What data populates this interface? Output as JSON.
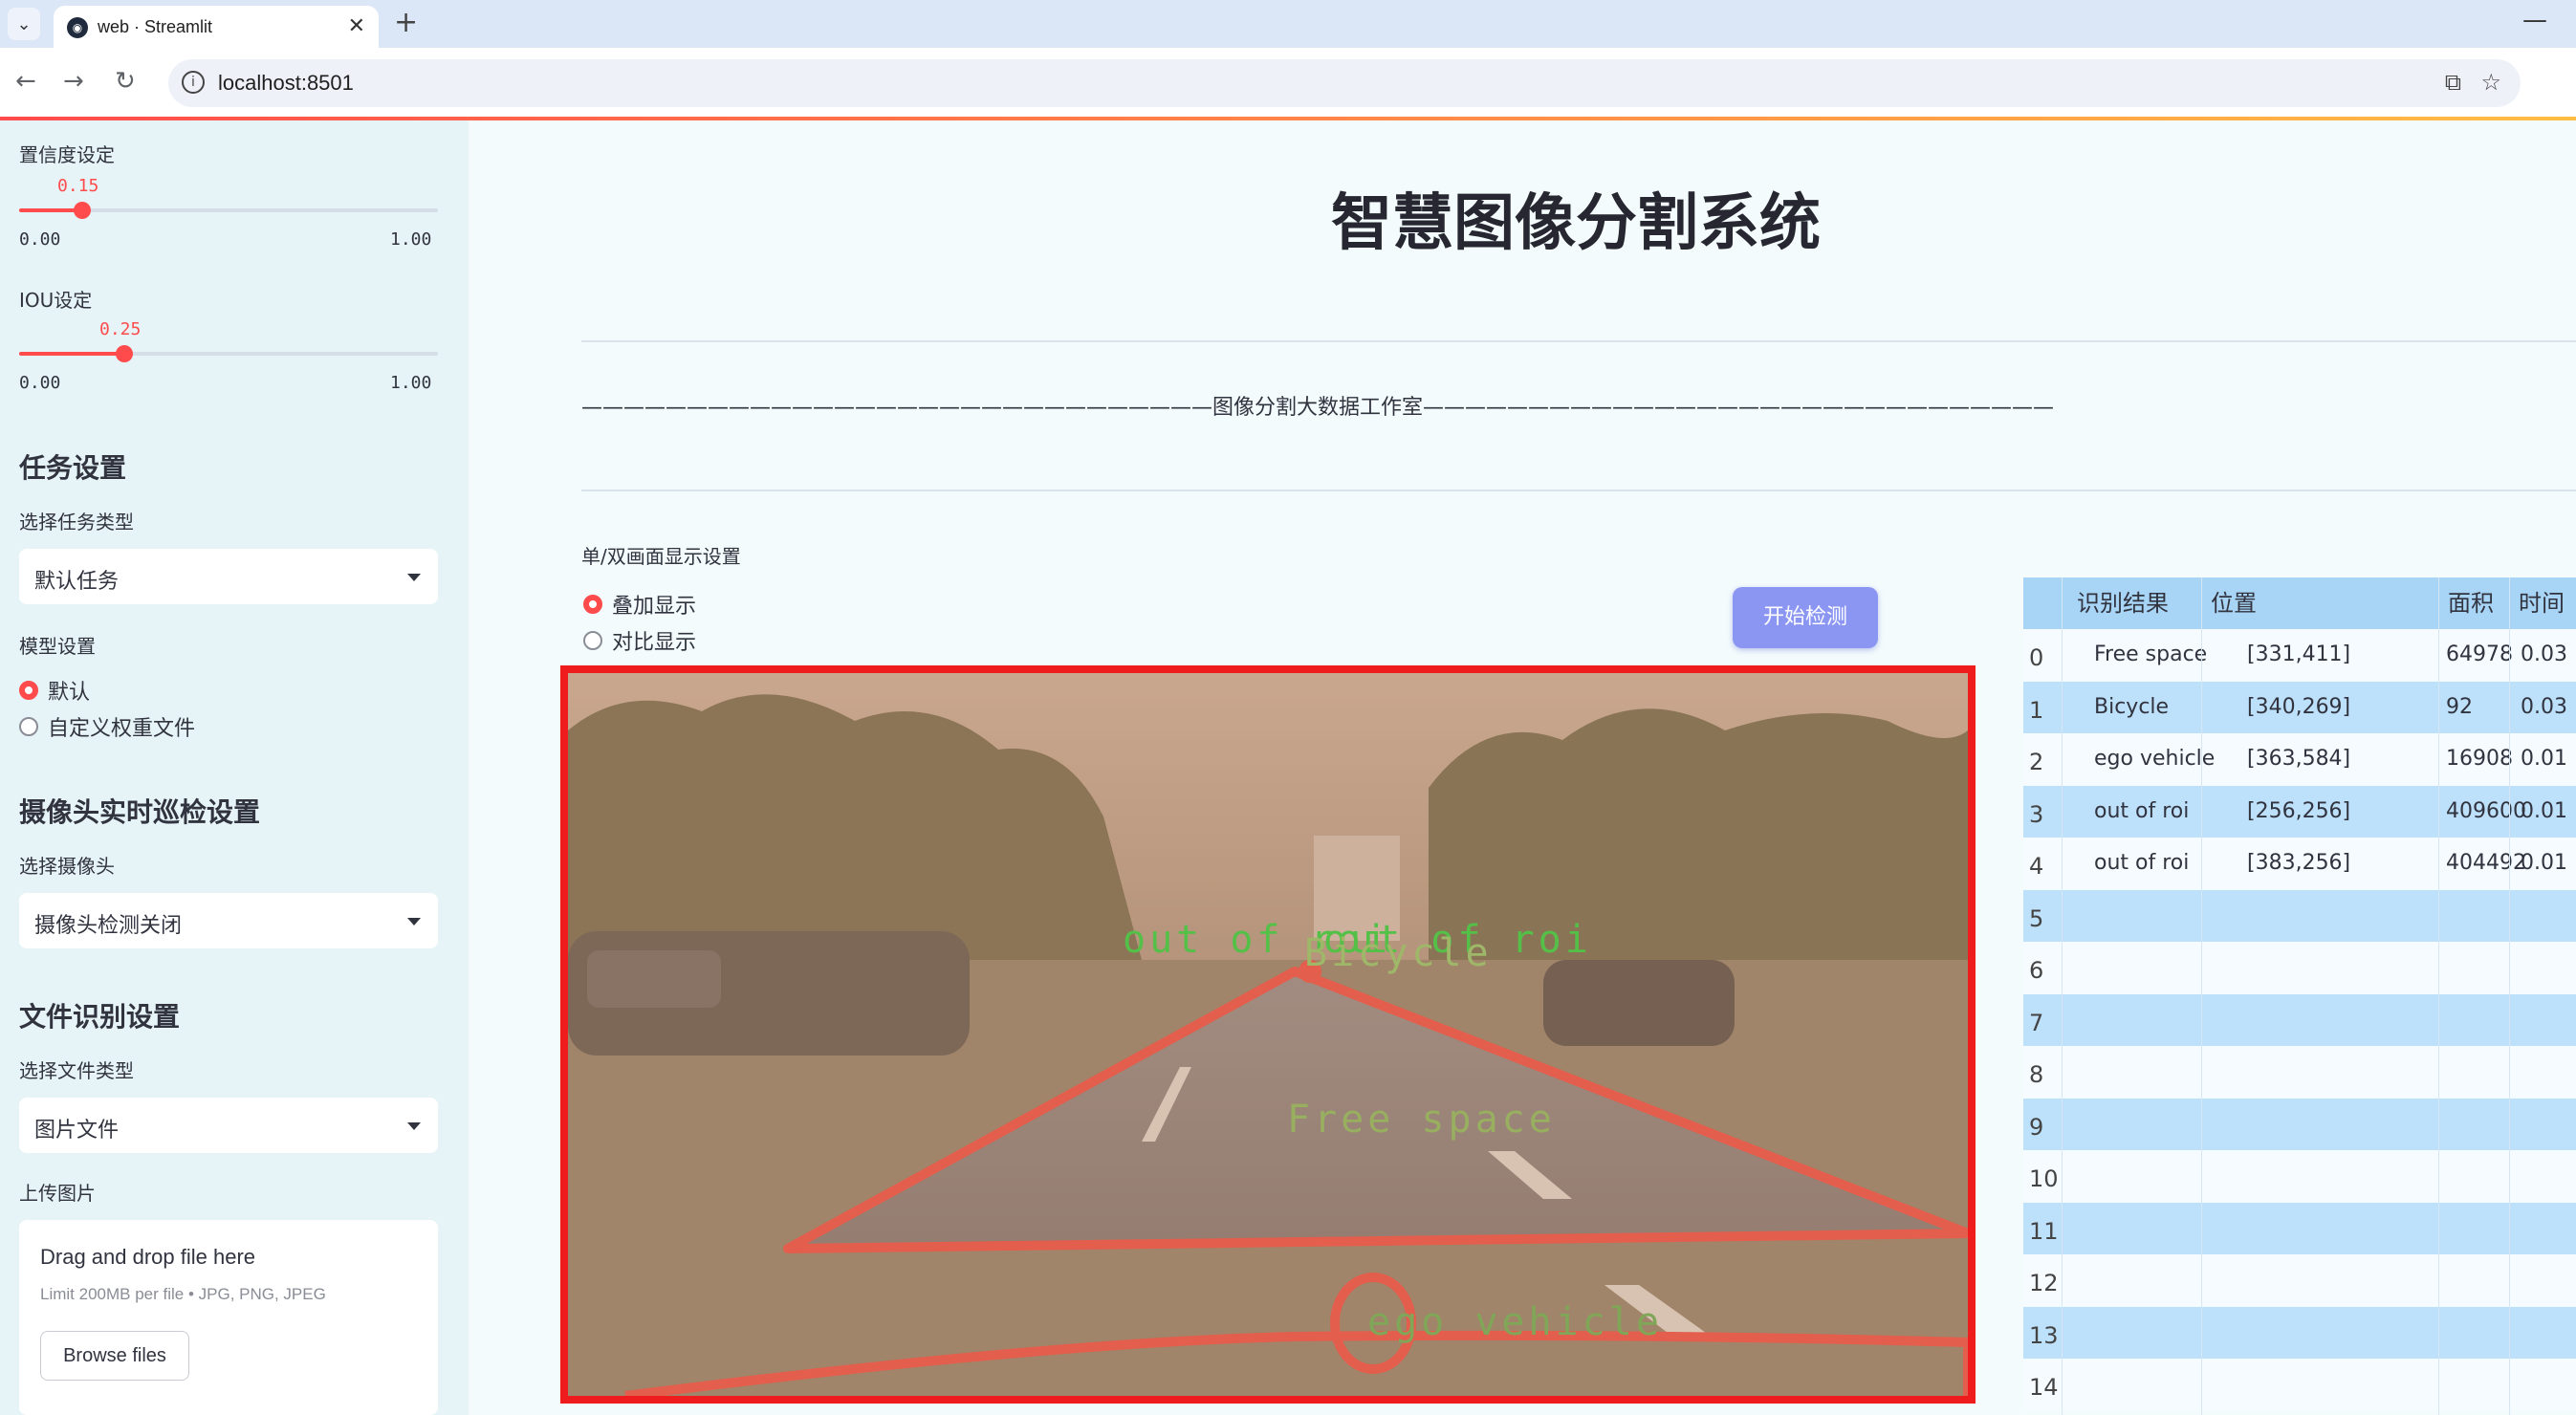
{
  "browser": {
    "tab_title": "web · Streamlit",
    "url": "localhost:8501"
  },
  "sidebar": {
    "confidence": {
      "label": "置信度设定",
      "value": "0.15",
      "min": "0.00",
      "max": "1.00",
      "fraction": 0.15
    },
    "iou": {
      "label": "IOU设定",
      "value": "0.25",
      "min": "0.00",
      "max": "1.00",
      "fraction": 0.25
    },
    "task_heading": "任务设置",
    "task_type_label": "选择任务类型",
    "task_type_value": "默认任务",
    "model_label": "模型设置",
    "model_options": [
      "默认",
      "自定义权重文件"
    ],
    "model_selected": 0,
    "camera_heading": "摄像头实时巡检设置",
    "camera_label": "选择摄像头",
    "camera_value": "摄像头检测关闭",
    "file_heading": "文件识别设置",
    "file_type_label": "选择文件类型",
    "file_type_value": "图片文件",
    "upload_label": "上传图片",
    "upload_drag": "Drag and drop file here",
    "upload_limit": "Limit 200MB per file • JPG, PNG, JPEG",
    "upload_button": "Browse files"
  },
  "main": {
    "title": "智慧图像分割系统",
    "banner": "——————————————————————————————图像分割大数据工作室——————————————————————————————",
    "display_label": "单/双画面显示设置",
    "display_options": [
      "叠加显示",
      "对比显示"
    ],
    "display_selected": 0,
    "start_button": "开始检测",
    "image_labels": [
      "out of roi",
      "out of roi",
      "Bicycle",
      "Free space",
      "ego vehicle"
    ]
  },
  "results_table": {
    "columns": [
      "识别结果",
      "位置",
      "面积",
      "时间"
    ],
    "rows": [
      {
        "idx": "0",
        "label": "Free space",
        "pos": "[331,411]",
        "area": "64978",
        "time": "0.03"
      },
      {
        "idx": "1",
        "label": "Bicycle",
        "pos": "[340,269]",
        "area": "92",
        "time": "0.03"
      },
      {
        "idx": "2",
        "label": "ego vehicle",
        "pos": "[363,584]",
        "area": "16908",
        "time": "0.01"
      },
      {
        "idx": "3",
        "label": "out of roi",
        "pos": "[256,256]",
        "area": "409600",
        "time": "0.01"
      },
      {
        "idx": "4",
        "label": "out of roi",
        "pos": "[383,256]",
        "area": "404492",
        "time": "0.01"
      },
      {
        "idx": "5",
        "label": "",
        "pos": "",
        "area": "",
        "time": ""
      },
      {
        "idx": "6",
        "label": "",
        "pos": "",
        "area": "",
        "time": ""
      },
      {
        "idx": "7",
        "label": "",
        "pos": "",
        "area": "",
        "time": ""
      },
      {
        "idx": "8",
        "label": "",
        "pos": "",
        "area": "",
        "time": ""
      },
      {
        "idx": "9",
        "label": "",
        "pos": "",
        "area": "",
        "time": ""
      },
      {
        "idx": "10",
        "label": "",
        "pos": "",
        "area": "",
        "time": ""
      },
      {
        "idx": "11",
        "label": "",
        "pos": "",
        "area": "",
        "time": ""
      },
      {
        "idx": "12",
        "label": "",
        "pos": "",
        "area": "",
        "time": ""
      },
      {
        "idx": "13",
        "label": "",
        "pos": "",
        "area": "",
        "time": ""
      },
      {
        "idx": "14",
        "label": "",
        "pos": "",
        "area": "",
        "time": ""
      }
    ]
  },
  "colors": {
    "accent": "#ff4b4b",
    "button": "#8b96f2",
    "frame": "#ee1c1c",
    "mask_label": "#22cc33",
    "contour": "#e8443a"
  }
}
